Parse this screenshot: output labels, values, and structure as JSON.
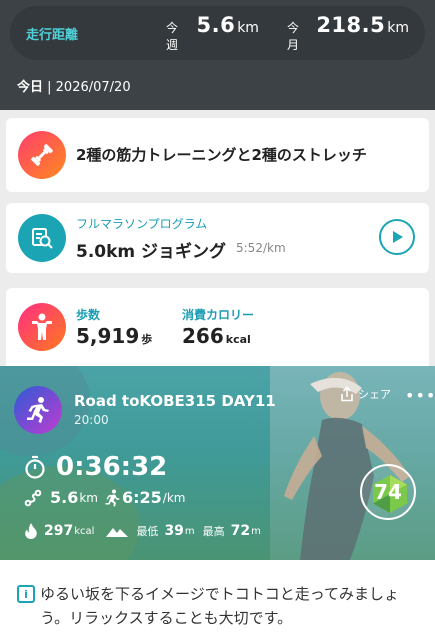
{
  "header": {
    "title": "走行距離",
    "week_label": "今週",
    "week_value": "5.6",
    "week_unit": "km",
    "month_label": "今月",
    "month_value": "218.5",
    "month_unit": "km",
    "today_label": "今日",
    "today_date": " | 2026/07/20"
  },
  "card_strength": {
    "title": "2種の筋力トレーニングと2種のストレッチ",
    "icon": "dumbbell-icon"
  },
  "card_program": {
    "program": "フルマラソンプログラム",
    "workout": "5.0km ジョギング",
    "pace": "5:52/km",
    "icon": "search-chart-icon"
  },
  "card_metrics": {
    "steps_label": "歩数",
    "steps_value": "5,919",
    "steps_unit": "歩",
    "calories_label": "消費カロリー",
    "calories_value": "266",
    "calories_unit": "kcal"
  },
  "activity": {
    "title": "Road toKOBE315 DAY11",
    "time": "20:00",
    "share_label": "シェア",
    "more": "•••",
    "duration": "0:36:32",
    "distance_value": "5.6",
    "distance_unit": "km",
    "pace_value": "6:25",
    "pace_unit": "/km",
    "calories_value": "297",
    "calories_unit": "kcal",
    "min_label": "最低",
    "min_value": "39",
    "min_unit": "m",
    "max_label": "最高",
    "max_value": "72",
    "max_unit": "m",
    "score": "74"
  },
  "note": {
    "text": "ゆるい坂を下るイメージでトコトコと走ってみましょう。リラックスすることも大切です。",
    "icon": "info-icon"
  },
  "colors": {
    "accent": "#1ba4b3",
    "header_bg": "#3d4246",
    "title_cyan": "#4fd1d9"
  }
}
